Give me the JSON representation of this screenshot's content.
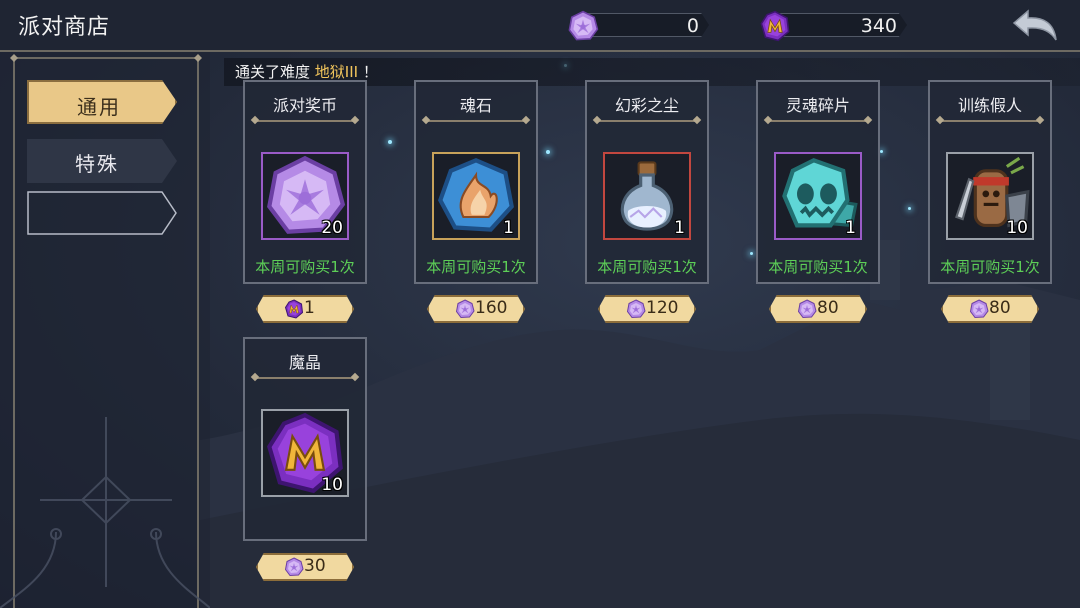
{
  "header": {
    "title": "派对商店"
  },
  "currencies": [
    {
      "name": "party-coin",
      "icon": "purple-flower-gem-icon",
      "value": "0"
    },
    {
      "name": "magic-crystal",
      "icon": "purple-m-crystal-icon",
      "value": "340"
    }
  ],
  "back": {
    "icon": "back-arrow-icon"
  },
  "sidebar": {
    "tabs": [
      {
        "label": "通用",
        "active": true
      },
      {
        "label": "特殊",
        "active": false
      }
    ]
  },
  "notice": {
    "prefix": "通关了难度 ",
    "highlight": "地狱III",
    "suffix": " ！"
  },
  "items": [
    {
      "name": "派对奖币",
      "icon": "purple-flower-gem-icon",
      "count": "20",
      "limit": "本周可购买1次",
      "price": "1",
      "price_icon": "purple-m-crystal-icon"
    },
    {
      "name": "魂石",
      "icon": "blue-flame-soulstone-icon",
      "count": "1",
      "limit": "本周可购买1次",
      "price": "160",
      "price_icon": "purple-flower-gem-icon"
    },
    {
      "name": "幻彩之尘",
      "icon": "potion-flask-icon",
      "count": "1",
      "limit": "本周可购买1次",
      "price": "120",
      "price_icon": "purple-flower-gem-icon"
    },
    {
      "name": "灵魂碎片",
      "icon": "cyan-skull-shard-icon",
      "count": "1",
      "limit": "本周可购买1次",
      "price": "80",
      "price_icon": "purple-flower-gem-icon"
    },
    {
      "name": "训练假人",
      "icon": "training-dummy-icon",
      "count": "10",
      "limit": "本周可购买1次",
      "price": "80",
      "price_icon": "purple-flower-gem-icon"
    },
    {
      "name": "魔晶",
      "icon": "purple-m-crystal-icon",
      "count": "10",
      "limit": "",
      "price": "30",
      "price_icon": "purple-flower-gem-icon"
    }
  ],
  "colors": {
    "gold_accent": "#e9c888",
    "limit_green": "#5dcf57",
    "notice_highlight": "#f2c55c",
    "frame_purple": "#9a5bc7",
    "frame_gold": "#c8a25a",
    "frame_red": "#c2473f",
    "frame_gray": "#9aa0a8"
  }
}
